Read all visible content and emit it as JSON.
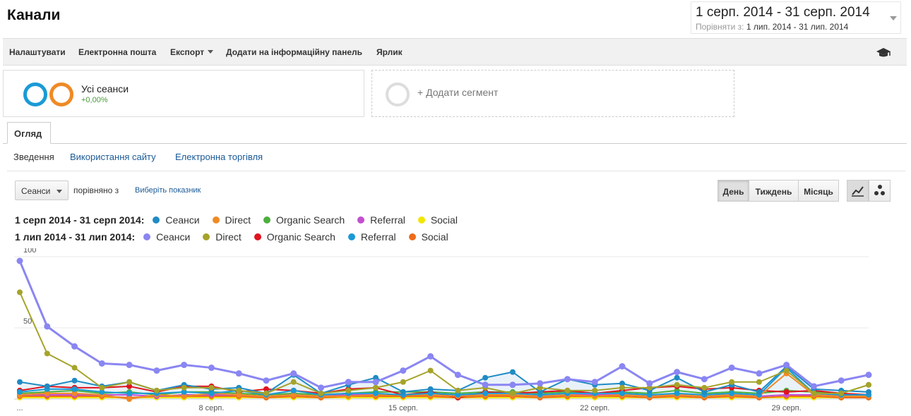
{
  "header": {
    "title": "Канали",
    "date_range": "1 серп. 2014 - 31 серп. 2014",
    "compare_label": "Порівняти з:",
    "compare_range": "1 лип. 2014 - 31 лип. 2014"
  },
  "toolbar": {
    "customize": "Налаштувати",
    "email": "Електронна пошта",
    "export": "Експорт",
    "add_dashboard": "Додати на інформаційну панель",
    "shortcut": "Ярлик",
    "academy_icon": "graduation-cap-icon"
  },
  "segments": {
    "all_sessions": "Усі сеанси",
    "all_sessions_pct": "+0,00%",
    "add_segment": "+ Додати сегмент",
    "ring_colors": [
      "#1a9ad6",
      "#ef8a25"
    ]
  },
  "tabs": {
    "overview": "Огляд"
  },
  "subtabs": {
    "summary": "Зведення",
    "site_usage": "Використання сайту",
    "ecommerce": "Електронна торгівля"
  },
  "controls": {
    "metric": "Сеанси",
    "compared_with": "порівняно з",
    "select_metric": "Виберіть показник",
    "day": "День",
    "week": "Тиждень",
    "month": "Місяць",
    "active_period": "День",
    "line_view_icon": "line-chart-icon",
    "motion_view_icon": "motion-chart-icon"
  },
  "legend": {
    "current_label": "1 серп 2014 - 31 серп 2014:",
    "previous_label": "1 лип 2014 - 31 лип 2014:",
    "current": [
      {
        "name": "Сеанси",
        "color": "#1f8bc4"
      },
      {
        "name": "Direct",
        "color": "#ef8a25"
      },
      {
        "name": "Organic Search",
        "color": "#4caf3e"
      },
      {
        "name": "Referral",
        "color": "#c34fd1"
      },
      {
        "name": "Social",
        "color": "#f2e600"
      }
    ],
    "previous": [
      {
        "name": "Сеанси",
        "color": "#8a86f2"
      },
      {
        "name": "Direct",
        "color": "#a6a32a"
      },
      {
        "name": "Organic Search",
        "color": "#e0131e"
      },
      {
        "name": "Referral",
        "color": "#1a9ad6"
      },
      {
        "name": "Social",
        "color": "#ef6c1a"
      }
    ]
  },
  "chart_data": {
    "type": "line",
    "x": [
      "1",
      "2",
      "3",
      "4",
      "5",
      "6",
      "7",
      "8",
      "9",
      "10",
      "11",
      "12",
      "13",
      "14",
      "15",
      "16",
      "17",
      "18",
      "19",
      "20",
      "21",
      "22",
      "23",
      "24",
      "25",
      "26",
      "27",
      "28",
      "29",
      "30",
      "31"
    ],
    "x_tick_labels": [
      {
        "x": "1",
        "label": "..."
      },
      {
        "x": "8",
        "label": "8 серп."
      },
      {
        "x": "15",
        "label": "15 серп."
      },
      {
        "x": "22",
        "label": "22 серп."
      },
      {
        "x": "29",
        "label": "29 серп."
      }
    ],
    "y_ticks": [
      "50",
      "100"
    ],
    "ylim": [
      0,
      100
    ],
    "grid": true,
    "series": [
      {
        "name": "Сеанси",
        "color": "#8a86f2",
        "width": 3,
        "values": [
          97,
          51,
          37,
          25,
          24,
          20,
          24,
          22,
          18,
          13,
          18,
          8,
          12,
          12,
          20,
          30,
          17,
          10,
          10,
          11,
          14,
          12,
          23,
          11,
          19,
          14,
          22,
          18,
          24,
          9,
          13,
          17
        ]
      },
      {
        "name": "Direct",
        "color": "#a6a32a",
        "width": 2,
        "values": [
          75,
          32,
          22,
          8,
          12,
          6,
          8,
          8,
          6,
          4,
          12,
          4,
          6,
          8,
          12,
          20,
          6,
          8,
          4,
          8,
          6,
          6,
          8,
          8,
          10,
          8,
          12,
          12,
          20,
          4,
          4,
          10
        ]
      },
      {
        "name": "Сеанси",
        "color": "#1f8bc4",
        "width": 2,
        "values": [
          12,
          9,
          13,
          9,
          12,
          6,
          10,
          7,
          8,
          4,
          17,
          4,
          10,
          15,
          5,
          7,
          6,
          15,
          19,
          5,
          14,
          10,
          11,
          6,
          15,
          5,
          10,
          5,
          23,
          7,
          6,
          5
        ]
      },
      {
        "name": "Referral",
        "color": "#1a9ad6",
        "width": 2,
        "values": [
          5,
          7,
          7,
          5,
          4,
          4,
          5,
          4,
          6,
          3,
          6,
          3,
          4,
          4,
          3,
          4,
          3,
          4,
          4,
          3,
          4,
          4,
          4,
          3,
          4,
          3,
          4,
          3,
          22,
          4,
          3,
          3
        ]
      },
      {
        "name": "Direct",
        "color": "#ef8a25",
        "width": 2,
        "values": [
          3,
          4,
          4,
          3,
          0,
          3,
          2,
          4,
          3,
          2,
          3,
          2,
          2,
          3,
          3,
          3,
          2,
          3,
          3,
          2,
          3,
          2,
          3,
          2,
          3,
          2,
          3,
          2,
          18,
          3,
          2,
          2
        ]
      },
      {
        "name": "Organic Search",
        "color": "#e0131e",
        "width": 2,
        "values": [
          6,
          9,
          8,
          8,
          9,
          5,
          9,
          9,
          5,
          7,
          6,
          4,
          7,
          8,
          3,
          5,
          1,
          5,
          4,
          5,
          6,
          4,
          6,
          8,
          9,
          7,
          8,
          6,
          5,
          6,
          4,
          3
        ]
      },
      {
        "name": "Organic Search",
        "color": "#4caf3e",
        "width": 2,
        "values": [
          4,
          5,
          6,
          4,
          5,
          3,
          5,
          5,
          4,
          3,
          4,
          3,
          4,
          5,
          5,
          5,
          4,
          5,
          5,
          4,
          5,
          4,
          5,
          4,
          6,
          4,
          5,
          4,
          6,
          5,
          4,
          10
        ]
      },
      {
        "name": "Referral",
        "color": "#c34fd1",
        "width": 2,
        "values": [
          3,
          3,
          3,
          3,
          3,
          2,
          3,
          3,
          3,
          2,
          3,
          2,
          3,
          3,
          3,
          3,
          2,
          3,
          3,
          2,
          3,
          3,
          3,
          2,
          3,
          2,
          3,
          2,
          3,
          3,
          2,
          2
        ]
      },
      {
        "name": "Social",
        "color": "#ef6c1a",
        "width": 2,
        "values": [
          2,
          2,
          2,
          2,
          1,
          2,
          2,
          2,
          2,
          1,
          2,
          1,
          2,
          2,
          2,
          2,
          1,
          2,
          2,
          1,
          2,
          2,
          2,
          1,
          2,
          1,
          2,
          1,
          2,
          2,
          1,
          1
        ]
      },
      {
        "name": "Social",
        "color": "#f2e600",
        "width": 2,
        "values": [
          1,
          1,
          1,
          1,
          1,
          1,
          1,
          1,
          1,
          1,
          1,
          1,
          1,
          1,
          1,
          1,
          1,
          1,
          1,
          1,
          1,
          1,
          1,
          1,
          1,
          1,
          1,
          1,
          1,
          1,
          1,
          1
        ]
      }
    ]
  }
}
